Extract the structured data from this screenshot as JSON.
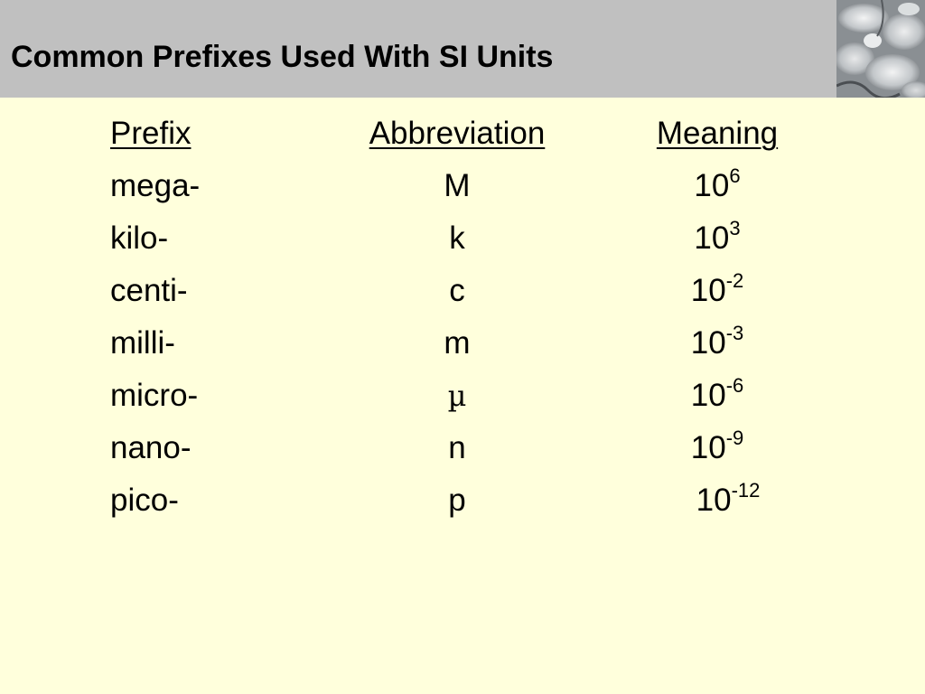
{
  "slide": {
    "title": "Common Prefixes Used With SI Units"
  },
  "table": {
    "headers": {
      "prefix": "Prefix",
      "abbreviation": "Abbreviation",
      "meaning": "Meaning"
    },
    "rows": [
      {
        "prefix": "mega-",
        "abbreviation": "M",
        "base": "10",
        "exponent": "6"
      },
      {
        "prefix": "kilo-",
        "abbreviation": "k",
        "base": "10",
        "exponent": "3"
      },
      {
        "prefix": "centi-",
        "abbreviation": "c",
        "base": "10",
        "exponent": "-2"
      },
      {
        "prefix": "milli-",
        "abbreviation": "m",
        "base": "10",
        "exponent": "-3"
      },
      {
        "prefix": "micro-",
        "abbreviation": "µ",
        "base": "10",
        "exponent": "-6"
      },
      {
        "prefix": "nano-",
        "abbreviation": "n",
        "base": "10",
        "exponent": "-9"
      },
      {
        "prefix": "pico-",
        "abbreviation": "p",
        "base": "10",
        "exponent": "-12"
      }
    ]
  },
  "colors": {
    "background": "#ffffdc",
    "title_bar": "#c0c0c0"
  },
  "icons": {
    "corner_image": "frost-ice-photo"
  }
}
